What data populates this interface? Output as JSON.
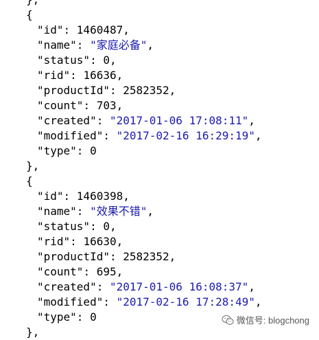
{
  "lines": [
    {
      "indent": false,
      "parts": [
        {
          "t": "p",
          "v": "},"
        }
      ]
    },
    {
      "indent": false,
      "parts": [
        {
          "t": "p",
          "v": "{"
        }
      ]
    },
    {
      "indent": true,
      "parts": [
        {
          "t": "k",
          "v": "\"id\""
        },
        {
          "t": "p",
          "v": ": "
        },
        {
          "t": "n",
          "v": "1460487"
        },
        {
          "t": "p",
          "v": ","
        }
      ]
    },
    {
      "indent": true,
      "parts": [
        {
          "t": "k",
          "v": "\"name\""
        },
        {
          "t": "p",
          "v": ": "
        },
        {
          "t": "s",
          "v": "\"家庭必备\""
        },
        {
          "t": "p",
          "v": ","
        }
      ]
    },
    {
      "indent": true,
      "parts": [
        {
          "t": "k",
          "v": "\"status\""
        },
        {
          "t": "p",
          "v": ": "
        },
        {
          "t": "n",
          "v": "0"
        },
        {
          "t": "p",
          "v": ","
        }
      ]
    },
    {
      "indent": true,
      "parts": [
        {
          "t": "k",
          "v": "\"rid\""
        },
        {
          "t": "p",
          "v": ": "
        },
        {
          "t": "n",
          "v": "16636"
        },
        {
          "t": "p",
          "v": ","
        }
      ]
    },
    {
      "indent": true,
      "parts": [
        {
          "t": "k",
          "v": "\"productId\""
        },
        {
          "t": "p",
          "v": ": "
        },
        {
          "t": "n",
          "v": "2582352"
        },
        {
          "t": "p",
          "v": ","
        }
      ]
    },
    {
      "indent": true,
      "parts": [
        {
          "t": "k",
          "v": "\"count\""
        },
        {
          "t": "p",
          "v": ": "
        },
        {
          "t": "n",
          "v": "703"
        },
        {
          "t": "p",
          "v": ","
        }
      ]
    },
    {
      "indent": true,
      "parts": [
        {
          "t": "k",
          "v": "\"created\""
        },
        {
          "t": "p",
          "v": ": "
        },
        {
          "t": "s",
          "v": "\"2017-01-06 17:08:11\""
        },
        {
          "t": "p",
          "v": ","
        }
      ]
    },
    {
      "indent": true,
      "parts": [
        {
          "t": "k",
          "v": "\"modified\""
        },
        {
          "t": "p",
          "v": ": "
        },
        {
          "t": "s",
          "v": "\"2017-02-16 16:29:19\""
        },
        {
          "t": "p",
          "v": ","
        }
      ]
    },
    {
      "indent": true,
      "parts": [
        {
          "t": "k",
          "v": "\"type\""
        },
        {
          "t": "p",
          "v": ": "
        },
        {
          "t": "n",
          "v": "0"
        }
      ]
    },
    {
      "indent": false,
      "parts": [
        {
          "t": "p",
          "v": "},"
        }
      ]
    },
    {
      "indent": false,
      "parts": [
        {
          "t": "p",
          "v": "{"
        }
      ]
    },
    {
      "indent": true,
      "parts": [
        {
          "t": "k",
          "v": "\"id\""
        },
        {
          "t": "p",
          "v": ": "
        },
        {
          "t": "n",
          "v": "1460398"
        },
        {
          "t": "p",
          "v": ","
        }
      ]
    },
    {
      "indent": true,
      "parts": [
        {
          "t": "k",
          "v": "\"name\""
        },
        {
          "t": "p",
          "v": ": "
        },
        {
          "t": "s",
          "v": "\"效果不错\""
        },
        {
          "t": "p",
          "v": ","
        }
      ]
    },
    {
      "indent": true,
      "parts": [
        {
          "t": "k",
          "v": "\"status\""
        },
        {
          "t": "p",
          "v": ": "
        },
        {
          "t": "n",
          "v": "0"
        },
        {
          "t": "p",
          "v": ","
        }
      ]
    },
    {
      "indent": true,
      "parts": [
        {
          "t": "k",
          "v": "\"rid\""
        },
        {
          "t": "p",
          "v": ": "
        },
        {
          "t": "n",
          "v": "16630"
        },
        {
          "t": "p",
          "v": ","
        }
      ]
    },
    {
      "indent": true,
      "parts": [
        {
          "t": "k",
          "v": "\"productId\""
        },
        {
          "t": "p",
          "v": ": "
        },
        {
          "t": "n",
          "v": "2582352"
        },
        {
          "t": "p",
          "v": ","
        }
      ]
    },
    {
      "indent": true,
      "parts": [
        {
          "t": "k",
          "v": "\"count\""
        },
        {
          "t": "p",
          "v": ": "
        },
        {
          "t": "n",
          "v": "695"
        },
        {
          "t": "p",
          "v": ","
        }
      ]
    },
    {
      "indent": true,
      "parts": [
        {
          "t": "k",
          "v": "\"created\""
        },
        {
          "t": "p",
          "v": ": "
        },
        {
          "t": "s",
          "v": "\"2017-01-06 16:08:37\""
        },
        {
          "t": "p",
          "v": ","
        }
      ]
    },
    {
      "indent": true,
      "parts": [
        {
          "t": "k",
          "v": "\"modified\""
        },
        {
          "t": "p",
          "v": ": "
        },
        {
          "t": "s",
          "v": "\"2017-02-16 17:28:49\""
        },
        {
          "t": "p",
          "v": ","
        }
      ]
    },
    {
      "indent": true,
      "parts": [
        {
          "t": "k",
          "v": "\"type\""
        },
        {
          "t": "p",
          "v": ": "
        },
        {
          "t": "n",
          "v": "0"
        }
      ]
    },
    {
      "indent": false,
      "parts": [
        {
          "t": "p",
          "v": "},"
        }
      ]
    }
  ],
  "watermark": {
    "icon": "wechat-icon",
    "text": "微信号: blogchong"
  },
  "colors": {
    "string": "#1a1ab0",
    "text": "#000000",
    "background": "#ffffff"
  }
}
